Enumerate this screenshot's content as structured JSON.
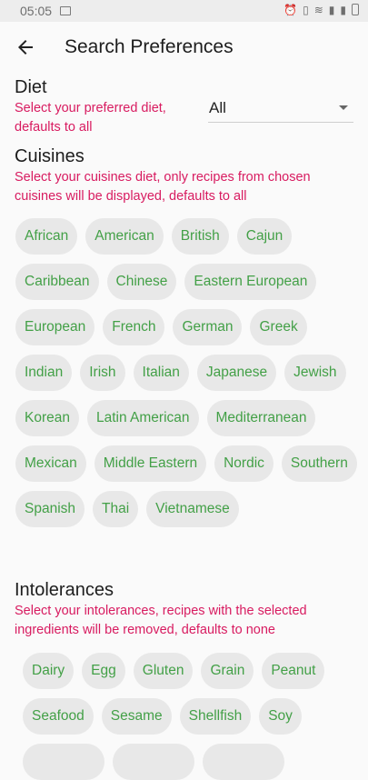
{
  "status_bar": {
    "time": "05:05"
  },
  "app_bar": {
    "title": "Search Preferences",
    "back_icon": "arrow-back-icon"
  },
  "diet": {
    "title": "Diet",
    "description": "Select your preferred diet, defaults to all",
    "selected": "All"
  },
  "cuisines": {
    "title": "Cuisines",
    "description": "Select your cuisines diet, only recipes from chosen cuisines will be displayed, defaults to all",
    "items": [
      "African",
      "American",
      "British",
      "Cajun",
      "Caribbean",
      "Chinese",
      "Eastern European",
      "European",
      "French",
      "German",
      "Greek",
      "Indian",
      "Irish",
      "Italian",
      "Japanese",
      "Jewish",
      "Korean",
      "Latin American",
      "Mediterranean",
      "Mexican",
      "Middle Eastern",
      "Nordic",
      "Southern",
      "Spanish",
      "Thai",
      "Vietnamese"
    ]
  },
  "intolerances": {
    "title": "Intolerances",
    "description": "Select your intolerances, recipes with the selected ingredients will be removed, defaults to none",
    "items": [
      "Dairy",
      "Egg",
      "Gluten",
      "Grain",
      "Peanut",
      "Seafood",
      "Sesame",
      "Shellfish",
      "Soy",
      "",
      "",
      ""
    ]
  },
  "colors": {
    "chip_text": "#43a047",
    "chip_bg": "#e8e8e8",
    "description": "#d81b60"
  }
}
